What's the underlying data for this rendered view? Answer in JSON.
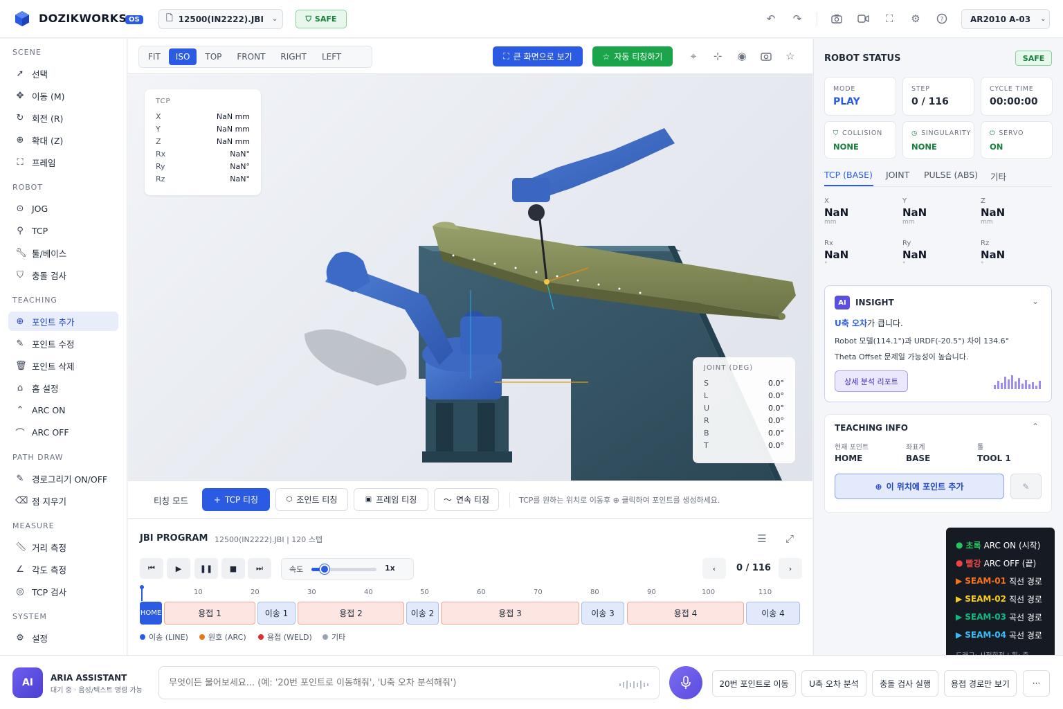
{
  "header": {
    "brand": "DOZIKWORKS",
    "os_badge": "OS",
    "file": "12500(IN2222).JBI",
    "safe_label": "SAFE",
    "robot_model": "AR2010 A-03",
    "icons": [
      "undo-icon",
      "redo-icon",
      "camera-icon",
      "video-icon",
      "fullscreen-icon",
      "settings-icon",
      "help-icon"
    ]
  },
  "sidebar": {
    "scene_title": "SCENE",
    "scene": [
      {
        "label": "선택",
        "icon": "cursor-icon"
      },
      {
        "label": "이동 (M)",
        "icon": "move-icon"
      },
      {
        "label": "회전 (R)",
        "icon": "rotate-icon"
      },
      {
        "label": "확대 (Z)",
        "icon": "zoom-icon"
      },
      {
        "label": "프레임",
        "icon": "frame-icon"
      }
    ],
    "robot_title": "ROBOT",
    "robot": [
      {
        "label": "JOG",
        "icon": "jog-icon"
      },
      {
        "label": "TCP",
        "icon": "tcp-icon"
      },
      {
        "label": "툴/베이스",
        "icon": "wrench-icon"
      },
      {
        "label": "충돌 검사",
        "icon": "shield-icon"
      }
    ],
    "teaching_title": "TEACHING",
    "teaching": [
      {
        "label": "포인트 추가",
        "icon": "plus-circle-icon"
      },
      {
        "label": "포인트 수정",
        "icon": "edit-icon"
      },
      {
        "label": "포인트 삭제",
        "icon": "trash-icon"
      },
      {
        "label": "홈 설정",
        "icon": "home-icon"
      },
      {
        "label": "ARC ON",
        "icon": "arc-on-icon"
      },
      {
        "label": "ARC OFF",
        "icon": "arc-off-icon"
      }
    ],
    "path_title": "PATH DRAW",
    "path": [
      {
        "label": "경로그리기 ON/OFF",
        "icon": "pen-icon"
      },
      {
        "label": "점 지우기",
        "icon": "eraser-icon"
      }
    ],
    "measure_title": "MEASURE",
    "measure": [
      {
        "label": "거리 측정",
        "icon": "ruler-icon"
      },
      {
        "label": "각도 측정",
        "icon": "angle-icon"
      },
      {
        "label": "TCP 검사",
        "icon": "target-icon"
      }
    ],
    "system_title": "SYSTEM",
    "system": [
      {
        "label": "설정",
        "icon": "gear-icon"
      }
    ]
  },
  "viewport": {
    "views": [
      "FIT",
      "ISO",
      "TOP",
      "FRONT",
      "RIGHT",
      "LEFT"
    ],
    "active_view": "ISO",
    "big_view_label": "큰 화면으로 보기",
    "auto_teach_label": "자동 티칭하기",
    "tcp": {
      "title": "TCP",
      "rows": [
        {
          "k": "X",
          "v": "NaN mm"
        },
        {
          "k": "Y",
          "v": "NaN mm"
        },
        {
          "k": "Z",
          "v": "NaN mm"
        },
        {
          "k": "Rx",
          "v": "NaN°"
        },
        {
          "k": "Ry",
          "v": "NaN°"
        },
        {
          "k": "Rz",
          "v": "NaN°"
        }
      ]
    },
    "joint": {
      "title": "JOINT (DEG)",
      "rows": [
        {
          "k": "S",
          "v": "0.0°"
        },
        {
          "k": "L",
          "v": "0.0°"
        },
        {
          "k": "U",
          "v": "0.0°"
        },
        {
          "k": "R",
          "v": "0.0°"
        },
        {
          "k": "B",
          "v": "0.0°"
        },
        {
          "k": "T",
          "v": "0.0°"
        }
      ]
    }
  },
  "teach_bar": {
    "mode_label": "티칭 모드",
    "buttons": [
      "TCP 티칭",
      "조인트 티칭",
      "프레임 티칭",
      "연속 티칭"
    ],
    "hint": "TCP를 원하는 위치로 이동후 ⊕ 클릭하여 포인트를 생성하세요."
  },
  "program": {
    "title": "JBI PROGRAM",
    "subtitle": "12500(IN2222).JBI | 120 스텝",
    "speed_label": "속도",
    "speed_value": "1x",
    "speed_fraction": 0.2,
    "step_display": "0 / 116",
    "ticks": [
      "10",
      "20",
      "30",
      "40",
      "50",
      "60",
      "70",
      "80",
      "90",
      "100",
      "110"
    ],
    "home_label": "HOME",
    "segments": [
      {
        "label": "용접 1",
        "type": "weld"
      },
      {
        "label": "이송 1",
        "type": "move"
      },
      {
        "label": "용접 2",
        "type": "weld"
      },
      {
        "label": "이송 2",
        "type": "move"
      },
      {
        "label": "용접 3",
        "type": "weld"
      },
      {
        "label": "이송 3",
        "type": "move"
      },
      {
        "label": "용접 4",
        "type": "weld"
      },
      {
        "label": "이송 4",
        "type": "move"
      }
    ],
    "legend": [
      {
        "label": "이송 (LINE)",
        "color": "#2b5be3"
      },
      {
        "label": "원호 (ARC)",
        "color": "#e07b1a"
      },
      {
        "label": "용접 (WELD)",
        "color": "#d8312d"
      },
      {
        "label": "기타",
        "color": "#9aa3b2"
      }
    ]
  },
  "robot_status": {
    "title": "ROBOT STATUS",
    "safe_label": "SAFE",
    "mode_label": "MODE",
    "mode_value": "PLAY",
    "step_label": "STEP",
    "step_value": "0 / 116",
    "cycle_label": "CYCLE TIME",
    "cycle_value": "00:00:00",
    "collision_label": "COLLISION",
    "collision_value": "NONE",
    "singularity_label": "SINGULARITY",
    "singularity_value": "NONE",
    "servo_label": "SERVO",
    "servo_value": "ON",
    "tabs": [
      "TCP (BASE)",
      "JOINT",
      "PULSE (ABS)",
      "기타"
    ],
    "coords": [
      {
        "k": "X",
        "v": "NaN",
        "u": "mm"
      },
      {
        "k": "Y",
        "v": "NaN",
        "u": "mm"
      },
      {
        "k": "Z",
        "v": "NaN",
        "u": "mm"
      },
      {
        "k": "Rx",
        "v": "NaN",
        "u": "°"
      },
      {
        "k": "Ry",
        "v": "NaN",
        "u": "°"
      },
      {
        "k": "Rz",
        "v": "NaN",
        "u": "°"
      }
    ]
  },
  "insight": {
    "badge": "AI",
    "title": "INSIGHT",
    "headline_strong": "U축 오차",
    "headline_rest": "가 큽니다.",
    "line1": "Robot 모델(114.1°)과 URDF(-20.5°) 차이 134.6°",
    "line2": "Theta Offset 문제일 가능성이 높습니다.",
    "button": "상세 분석 리포트",
    "bars": [
      6,
      12,
      9,
      18,
      14,
      20,
      11,
      16,
      8,
      13,
      7,
      10,
      5,
      12
    ]
  },
  "teaching_info": {
    "title": "TEACHING INFO",
    "point_label": "현재 포인트",
    "point_value": "HOME",
    "coord_label": "좌표계",
    "coord_value": "BASE",
    "tool_label": "툴",
    "tool_value": "TOOL 1",
    "add_button": "이 위치에 포인트 추가"
  },
  "legend_popup": {
    "items": [
      {
        "marker": "●",
        "color": "#22c55e",
        "strong": "초록",
        "rest": "ARC ON (시작)"
      },
      {
        "marker": "●",
        "color": "#ef4444",
        "strong": "빨강",
        "rest": "ARC OFF (끝)"
      },
      {
        "marker": "▶",
        "color": "#f97316",
        "strong": "SEAM-01",
        "rest": "직선 경로"
      },
      {
        "marker": "▶",
        "color": "#facc15",
        "strong": "SEAM-02",
        "rest": "직선 경로"
      },
      {
        "marker": "▶",
        "color": "#10b981",
        "strong": "SEAM-03",
        "rest": "곡선 경로"
      },
      {
        "marker": "▶",
        "color": "#38bdf8",
        "strong": "SEAM-04",
        "rest": "곡선 경로"
      }
    ],
    "footer": "드래그: 시점회전 | 휠: 줌"
  },
  "assistant": {
    "avatar": "AI",
    "name": "ARIA ASSISTANT",
    "status": "대기 중 · 음성/텍스트 명령 가능",
    "placeholder": "무엇이든 물어보세요... (예: '20번 포인트로 이동해줘', 'U축 오차 분석해줘')",
    "chips": [
      "20번 포인트로 이동",
      "U축 오차 분석",
      "충돌 검사 실행",
      "용접 경로만 보기"
    ],
    "more": "···"
  }
}
